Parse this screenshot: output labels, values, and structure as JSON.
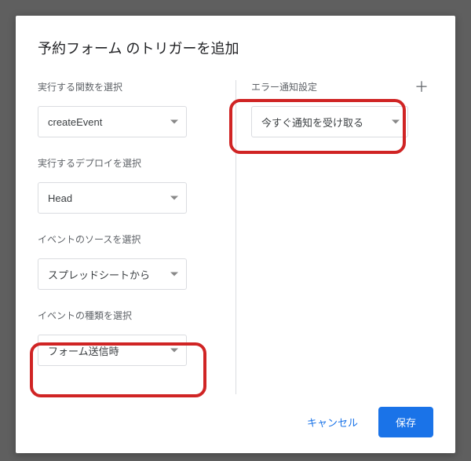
{
  "title": "予約フォーム のトリガーを追加",
  "left": {
    "fields": [
      {
        "label": "実行する関数を選択",
        "value": "createEvent"
      },
      {
        "label": "実行するデプロイを選択",
        "value": "Head"
      },
      {
        "label": "イベントのソースを選択",
        "value": "スプレッドシートから"
      },
      {
        "label": "イベントの種類を選択",
        "value": "フォーム送信時"
      }
    ]
  },
  "right": {
    "label": "エラー通知設定",
    "plus": "＋",
    "value": "今すぐ通知を受け取る"
  },
  "footer": {
    "cancel": "キャンセル",
    "save": "保存"
  }
}
